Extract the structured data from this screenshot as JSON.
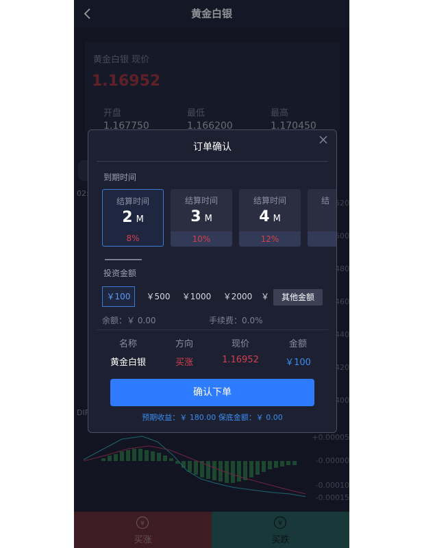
{
  "header": {
    "title": "黄金白银"
  },
  "quote": {
    "label": "黄金白银 现价",
    "price": "1.16952",
    "stats": [
      {
        "label": "开盘",
        "value": "1.167750"
      },
      {
        "label": "最低",
        "value": "1.166200"
      },
      {
        "label": "最高",
        "value": "1.170450"
      }
    ]
  },
  "chart": {
    "time_label": "02:",
    "axis_values": [
      "520",
      "500",
      "480",
      "460",
      "440",
      "420",
      "400"
    ],
    "macd_label": "DIF",
    "macd_axis": [
      "+0.00005",
      "-0.00000",
      "-0.00010",
      "-0.00015"
    ]
  },
  "modal": {
    "title": "订单确认",
    "expiry_label": "到期时间",
    "durations": [
      {
        "head": "结算时间",
        "value": "2",
        "unit": "M",
        "rate": "8%"
      },
      {
        "head": "结算时间",
        "value": "3",
        "unit": "M",
        "rate": "10%"
      },
      {
        "head": "结算时间",
        "value": "4",
        "unit": "M",
        "rate": "12%"
      },
      {
        "head": "结"
      }
    ],
    "amount_label": "投资金额",
    "amounts": [
      "￥100",
      "￥500",
      "￥1000",
      "￥2000",
      "￥"
    ],
    "other_amount": "其他金额",
    "balance": "余额：￥ 0.00",
    "fee": "手续费：0.0%",
    "table": {
      "headers": [
        "名称",
        "方向",
        "现价",
        "金额"
      ],
      "row": [
        "黄金白银",
        "买涨",
        "1.16952",
        "￥100"
      ]
    },
    "confirm_button": "确认下单",
    "footer": "预期收益：￥ 180.00    保底金额：￥ 0.00"
  },
  "bottom": {
    "rise": "买涨",
    "fall": "买跌"
  },
  "colors": {
    "accent": "#2f7bff",
    "rise": "#d4404d",
    "fall": "#255e59"
  }
}
